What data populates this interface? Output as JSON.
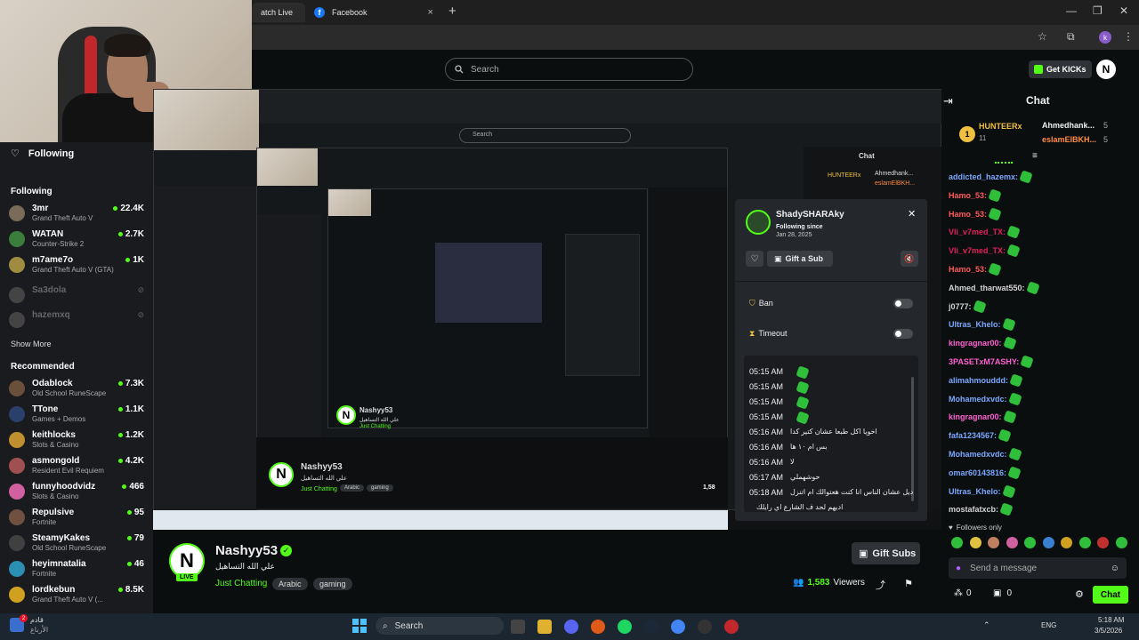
{
  "browser": {
    "tabs": [
      {
        "label": "atch Live"
      },
      {
        "label": "Facebook"
      }
    ],
    "tab_close": "×",
    "new_tab": "+",
    "win_minimize": "—",
    "win_restore": "❐",
    "win_close": "✕",
    "profile_initial": "k"
  },
  "header": {
    "search_placeholder": "Search",
    "get_kicks": "Get KICKs",
    "logo_initial": "N"
  },
  "sidebar": {
    "following_title": "Following",
    "following_label": "Following",
    "following": [
      {
        "name": "3mr",
        "game": "Grand Theft Auto V",
        "count": "22.4K",
        "live": true,
        "color": "#7a6a5a"
      },
      {
        "name": "WATAN",
        "game": "Counter-Strike 2",
        "count": "2.7K",
        "live": true,
        "color": "#3b7d3b"
      },
      {
        "name": "m7ame7o",
        "game": "Grand Theft Auto V (GTA)",
        "count": "1K",
        "live": true,
        "color": "#a08c40"
      },
      {
        "name": "Sa3dola",
        "game": "",
        "count": "",
        "live": false,
        "color": "#444"
      },
      {
        "name": "hazemxq",
        "game": "",
        "count": "",
        "live": false,
        "color": "#444"
      }
    ],
    "show_more": "Show More",
    "recommended_label": "Recommended",
    "recommended": [
      {
        "name": "Odablock",
        "game": "Old School RuneScape",
        "count": "7.3K",
        "color": "#6a4f3a"
      },
      {
        "name": "TTone",
        "game": "Games + Demos",
        "count": "1.1K",
        "color": "#2a3f6a"
      },
      {
        "name": "keithlocks",
        "game": "Slots & Casino",
        "count": "1.2K",
        "color": "#c09030"
      },
      {
        "name": "asmongold",
        "game": "Resident Evil Requiem",
        "count": "4.2K",
        "color": "#a05050"
      },
      {
        "name": "funnyhoodvidz",
        "game": "Slots & Casino",
        "count": "466",
        "color": "#d060a0"
      },
      {
        "name": "Repulsive",
        "game": "Fortnite",
        "count": "95",
        "color": "#705040"
      },
      {
        "name": "SteamyKakes",
        "game": "Old School RuneScape",
        "count": "79",
        "color": "#404040"
      },
      {
        "name": "heyimnatalia",
        "game": "Fortnite",
        "count": "46",
        "color": "#2a8fb0"
      },
      {
        "name": "lordkebun",
        "game": "Grand Theft Auto V (...",
        "count": "8.5K",
        "color": "#d0a020"
      }
    ]
  },
  "usercard": {
    "username": "ShadySHARAky",
    "following_since_label": "Following since",
    "following_since_date": "Jan 28, 2025",
    "close": "✕",
    "gift_sub": "Gift a Sub",
    "ban_label": "Ban",
    "timeout_label": "Timeout",
    "messages": [
      {
        "time": "05:15 AM",
        "text": ""
      },
      {
        "time": "05:15 AM",
        "text": ""
      },
      {
        "time": "05:15 AM",
        "text": ""
      },
      {
        "time": "05:15 AM",
        "text": ""
      },
      {
        "time": "05:16 AM",
        "text": "اخويا اكل طبعا عشان كتير كدا"
      },
      {
        "time": "05:16 AM",
        "text": "بس ام ١٠ ها"
      },
      {
        "time": "05:16 AM",
        "text": "لا"
      },
      {
        "time": "05:17 AM",
        "text": "حوشهملي"
      },
      {
        "time": "05:18 AM",
        "text": "ديل عشان الناس انا كنت هعتوالك ام اتنزل"
      },
      {
        "time": "",
        "text": "اديهم لحد ف الشارع اي رايلك"
      }
    ]
  },
  "stream": {
    "streamer": "Nashyy53",
    "title": "علي الله التساهيل",
    "category": "Just Chatting",
    "tags": [
      "Arabic",
      "gaming"
    ],
    "live_badge": "LIVE",
    "gift_subs": "Gift Subs",
    "viewers": "1,583",
    "viewers_label": "Viewers"
  },
  "nested": {
    "streamer": "Nashyy53",
    "title": "علي الله التساهيل",
    "category": "Just Chatting",
    "tags": [
      "Arabic",
      "gaming"
    ],
    "viewers": "1,58",
    "chat_title": "Chat",
    "hunter": "HUNTEERx",
    "ahmed": "Ahmedhank...",
    "eslam": "eslamElBKH..."
  },
  "chat": {
    "title": "Chat",
    "leaders": [
      {
        "name": "HUNTEERx",
        "score": "11",
        "rank": "1"
      },
      {
        "name": "Ahmedhank...",
        "score": "5"
      },
      {
        "name": "eslamElBKH...",
        "score": "5"
      }
    ],
    "messages": [
      {
        "name": "addicted_hazemx:",
        "color": "#7aa8ff"
      },
      {
        "name": "Hamo_53:",
        "color": "#ff5a5a"
      },
      {
        "name": "Hamo_53:",
        "color": "#ff5a5a"
      },
      {
        "name": "Vli_v7med_TX:",
        "color": "#e0205a"
      },
      {
        "name": "Vli_v7med_TX:",
        "color": "#e0205a"
      },
      {
        "name": "Hamo_53:",
        "color": "#ff5a5a"
      },
      {
        "name": "Ahmed_tharwat550:",
        "color": "#d4d4d4"
      },
      {
        "name": "j0777:",
        "color": "#d4d4d4"
      },
      {
        "name": "Ultras_Khelo:",
        "color": "#7aa8ff"
      },
      {
        "name": "kingragnar00:",
        "color": "#ff60d0"
      },
      {
        "name": "3PASETxM7ASHY:",
        "color": "#ff60d0"
      },
      {
        "name": "alimahmouddd:",
        "color": "#7aa8ff"
      },
      {
        "name": "Mohamedxvdc:",
        "color": "#7aa8ff"
      },
      {
        "name": "kingragnar00:",
        "color": "#ff60d0"
      },
      {
        "name": "fafa1234567:",
        "color": "#7aa8ff"
      },
      {
        "name": "Mohamedxvdc:",
        "color": "#7aa8ff"
      },
      {
        "name": "omar60143816:",
        "color": "#7aa8ff"
      },
      {
        "name": "Ultras_Khelo:",
        "color": "#7aa8ff"
      },
      {
        "name": "mostafatxcb:",
        "color": "#d4d4d4"
      }
    ],
    "followers_only": "Followers only",
    "send_placeholder": "Send a message",
    "counter": "0",
    "counter2": "0",
    "chat_button": "Chat"
  },
  "taskbar": {
    "search": "Search",
    "notif_count": "2",
    "weather_line1": "قادم",
    "weather_line2": "الأرباع",
    "lang": "ENG",
    "time": "5:18 AM",
    "date": "3/5/2026"
  }
}
